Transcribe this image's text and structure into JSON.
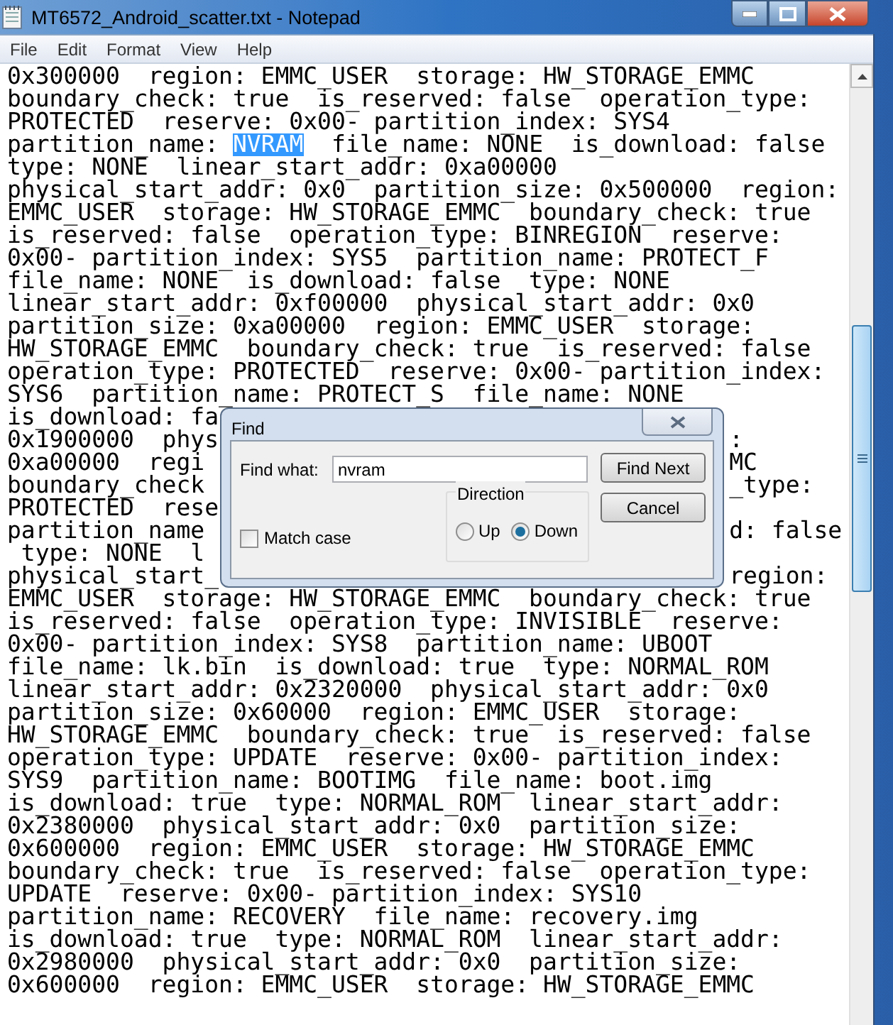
{
  "window": {
    "title": "MT6572_Android_scatter.txt - Notepad"
  },
  "menu": [
    "File",
    "Edit",
    "Format",
    "View",
    "Help"
  ],
  "editor": {
    "lines": [
      {
        "text": "0x300000  region: EMMC_USER  storage: HW_STORAGE_EMMC"
      },
      {
        "text": "boundary_check: true  is_reserved: false  operation_type:"
      },
      {
        "text": "PROTECTED  reserve: 0x00- partition_index: SYS4"
      },
      {
        "text": "partition_name: ",
        "selection": "NVRAM",
        "rest": "  file_name: NONE  is_download: false"
      },
      {
        "text": "type: NONE  linear_start_addr: 0xa00000"
      },
      {
        "text": "physical_start_addr: 0x0  partition_size: 0x500000  region:"
      },
      {
        "text": "EMMC_USER  storage: HW_STORAGE_EMMC  boundary_check: true"
      },
      {
        "text": "is_reserved: false  operation_type: BINREGION  reserve:"
      },
      {
        "text": "0x00- partition_index: SYS5  partition_name: PROTECT_F"
      },
      {
        "text": "file_name: NONE  is_download: false  type: NONE"
      },
      {
        "text": "linear_start_addr: 0xf00000  physical_start_addr: 0x0"
      },
      {
        "text": "partition_size: 0xa00000  region: EMMC_USER  storage:"
      },
      {
        "text": "HW_STORAGE_EMMC  boundary_check: true  is_reserved: false"
      },
      {
        "text": "operation_type: PROTECTED  reserve: 0x00- partition_index:"
      },
      {
        "text": "SYS6  partition_name: PROTECT_S  file_name: NONE"
      },
      {
        "text": "is_download: fa"
      },
      {
        "text": "0x1900000  phys",
        "right": ":"
      },
      {
        "text": "0xa00000  regi",
        "right": "MC"
      },
      {
        "text": "boundary_check",
        "right": "_type:"
      },
      {
        "text": "PROTECTED  rese"
      },
      {
        "text": "partition_name",
        "right": "d: false"
      },
      {
        "text": " type: NONE  l"
      },
      {
        "text": "physical_start_",
        "right": "region:"
      },
      {
        "text": "EMMC_USER  storage: HW_STORAGE_EMMC  boundary_check: true"
      },
      {
        "text": "is_reserved: false  operation_type: INVISIBLE  reserve:"
      },
      {
        "text": "0x00- partition_index: SYS8  partition_name: UBOOT"
      },
      {
        "text": "file_name: lk.bin  is_download: true  type: NORMAL_ROM"
      },
      {
        "text": "linear_start_addr: 0x2320000  physical_start_addr: 0x0"
      },
      {
        "text": "partition_size: 0x60000  region: EMMC_USER  storage:"
      },
      {
        "text": "HW_STORAGE_EMMC  boundary_check: true  is_reserved: false"
      },
      {
        "text": "operation_type: UPDATE  reserve: 0x00- partition_index:"
      },
      {
        "text": "SYS9  partition_name: BOOTIMG  file_name: boot.img"
      },
      {
        "text": "is_download: true  type: NORMAL_ROM  linear_start_addr:"
      },
      {
        "text": "0x2380000  physical_start_addr: 0x0  partition_size:"
      },
      {
        "text": "0x600000  region: EMMC_USER  storage: HW_STORAGE_EMMC"
      },
      {
        "text": "boundary_check: true  is_reserved: false  operation_type:"
      },
      {
        "text": "UPDATE  reserve: 0x00- partition_index: SYS10"
      },
      {
        "text": "partition_name: RECOVERY  file_name: recovery.img"
      },
      {
        "text": "is_download: true  type: NORMAL_ROM  linear_start_addr:"
      },
      {
        "text": "0x2980000  physical_start_addr: 0x0  partition_size:"
      },
      {
        "text": "0x600000  region: EMMC_USER  storage: HW_STORAGE_EMMC"
      }
    ]
  },
  "find_dialog": {
    "title": "Find",
    "find_what_label": "Find what:",
    "find_what_value": "nvram",
    "match_case": {
      "label": "Match case",
      "checked": false
    },
    "direction": {
      "label": "Direction",
      "options": [
        {
          "label": "Up",
          "selected": false
        },
        {
          "label": "Down",
          "selected": true
        }
      ]
    },
    "buttons": [
      "Find Next",
      "Cancel"
    ]
  }
}
